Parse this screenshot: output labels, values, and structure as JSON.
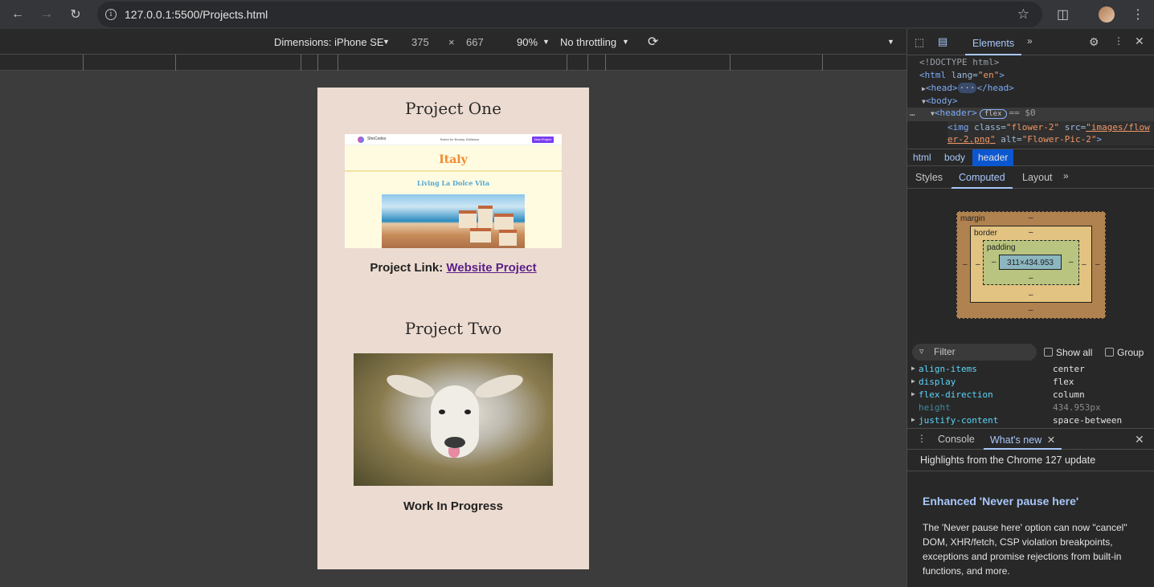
{
  "browser": {
    "url": "127.0.0.1:5500/Projects.html"
  },
  "device_toolbar": {
    "dimensions_label": "Dimensions: iPhone SE",
    "width": "375",
    "times": "×",
    "height": "667",
    "zoom": "90%",
    "throttling": "No throttling"
  },
  "page": {
    "project1_title": "Project One",
    "shot": {
      "brand": "SheCodes",
      "nav_text": "Tested for Beauty, Brilliance",
      "new_project": "New Project",
      "heading": "Italy",
      "subheading": "Living La Dolce Vita"
    },
    "link_prefix": "Project Link: ",
    "link_text": "Website Project",
    "project2_title": "Project Two",
    "wip": "Work In Progress"
  },
  "devtools": {
    "tab_elements": "Elements",
    "dom": {
      "doctype": "<!DOCTYPE html>",
      "html_open": "<html",
      "lang_attr": " lang=",
      "lang_val": "\"en\"",
      "html_close": ">",
      "head_open": "<head>",
      "head_dots": "···",
      "head_close": "</head>",
      "body": "<body>",
      "header": "<header>",
      "flex_badge": "flex",
      "eq": "== $0",
      "img_open": "<img",
      "class_attr": " class=",
      "class_val": "\"flower-2\"",
      "src_attr": " src=",
      "src_val1": "\"images/flow",
      "src_val2": "er-2.png\"",
      "alt_attr": " alt=",
      "alt_val": "\"Flower-Pic-2\"",
      "img_close": ">"
    },
    "breadcrumb": [
      "html",
      "body",
      "header"
    ],
    "subtabs": [
      "Styles",
      "Computed",
      "Layout"
    ],
    "box": {
      "margin": "margin",
      "border": "border",
      "padding": "padding",
      "dash": "–",
      "content": "311×434.953"
    },
    "filter_placeholder": "Filter",
    "show_all": "Show all",
    "group": "Group",
    "properties": [
      {
        "name": "align-items",
        "value": "center"
      },
      {
        "name": "display",
        "value": "flex"
      },
      {
        "name": "flex-direction",
        "value": "column"
      },
      {
        "name": "height",
        "value": "434.953px"
      },
      {
        "name": "justify-content",
        "value": "space-between"
      }
    ],
    "drawer_tabs": [
      "Console",
      "What's new"
    ],
    "highlights": "Highlights from the Chrome 127 update",
    "whatsnew_title": "Enhanced 'Never pause here'",
    "whatsnew_body": "The 'Never pause here' option can now \"cancel\" DOM, XHR/fetch, CSP violation breakpoints, exceptions and promise rejections from built-in functions, and more."
  },
  "colors": {
    "page_bg": "#ecdbd0",
    "link": "#5a1f8a",
    "accent_tab": "#a8c7fa"
  }
}
